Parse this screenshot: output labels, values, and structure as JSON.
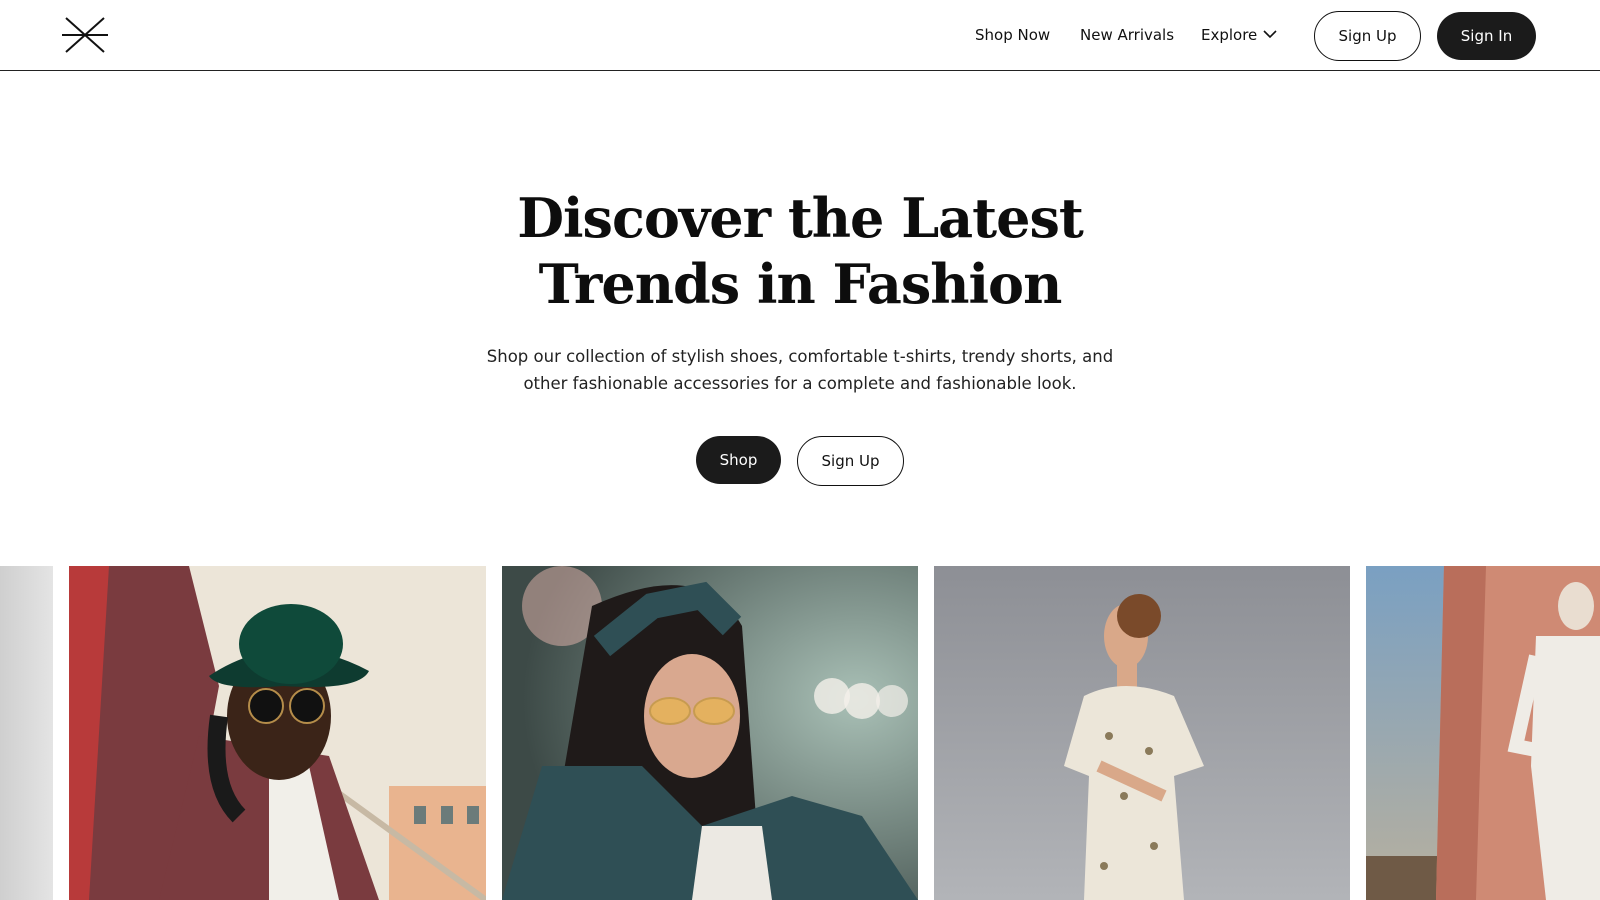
{
  "header": {
    "nav": {
      "shop_now": "Shop Now",
      "new_arrivals": "New Arrivals",
      "explore": "Explore"
    },
    "sign_up_label": "Sign Up",
    "sign_in_label": "Sign In"
  },
  "hero": {
    "title_line1": "Discover the Latest",
    "title_line2": "Trends in Fashion",
    "subtitle_line1": "Shop our collection of stylish shoes, comfortable t-shirts, trendy shorts, and",
    "subtitle_line2": "other fashionable accessories for a complete and fashionable look.",
    "shop_label": "Shop",
    "sign_up_label": "Sign Up"
  },
  "gallery": {
    "photos": [
      {
        "subject": "woman-in-green-hat-and-plaid-suit"
      },
      {
        "subject": "woman-in-denim-jacket-and-tinted-glasses"
      },
      {
        "subject": "woman-in-floral-dress"
      },
      {
        "subject": "person-in-white-coat-by-pink-wall"
      }
    ]
  },
  "colors": {
    "primary_dark": "#1b1b1b",
    "background": "#ffffff",
    "text": "#111111"
  }
}
